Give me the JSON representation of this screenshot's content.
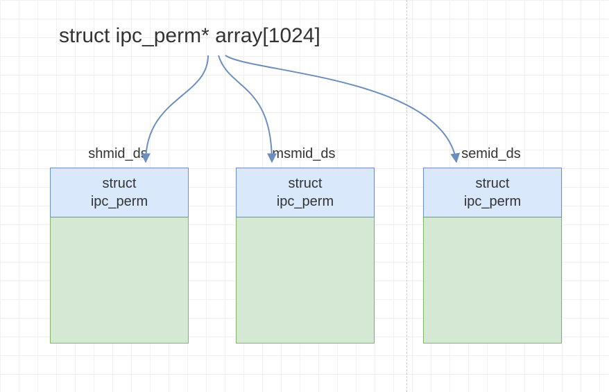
{
  "title": "struct ipc_perm* array[1024]",
  "boxes": [
    {
      "label": "shmid_ds",
      "header": "struct\nipc_perm"
    },
    {
      "label": "msmid_ds",
      "header": "struct\nipc_perm"
    },
    {
      "label": "semid_ds",
      "header": "struct\nipc_perm"
    }
  ],
  "colors": {
    "header_fill": "#dae8fc",
    "header_stroke": "#6c8ebf",
    "body_fill": "#d5e8d4",
    "body_stroke": "#82b366",
    "arrow": "#6c8ebf"
  }
}
